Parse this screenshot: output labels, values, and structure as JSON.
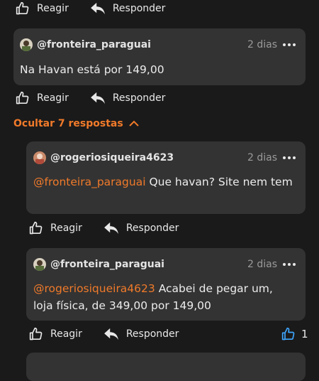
{
  "actions": {
    "like_label": "Reagir",
    "reply_label": "Responder"
  },
  "comment_main": {
    "author": "@fronteira_paraguai",
    "age": "2 dias",
    "text": "Na Havan está por 149,00"
  },
  "replies_toggle": {
    "label": "Ocultar 7 respostas"
  },
  "reply1": {
    "author": "@rogeriosiqueira4623",
    "age": "2 dias",
    "mention": "@fronteira_paraguai",
    "text": " Que havan? Site nem tem"
  },
  "reply2": {
    "author": "@fronteira_paraguai",
    "age": "2 dias",
    "mention": "@rogeriosiqueira4623",
    "text": " Acabei de pegar um, loja física, de 349,00 por 149,00",
    "like_count": "1"
  },
  "colors": {
    "accent": "#f07a2a",
    "like_active": "#3ea6ff",
    "card_bg": "#333333",
    "page_bg": "#1a1a1a"
  },
  "icons": [
    "thumbs-up-icon",
    "reply-arrow-icon",
    "more-dots-icon",
    "chevron-up-icon"
  ]
}
